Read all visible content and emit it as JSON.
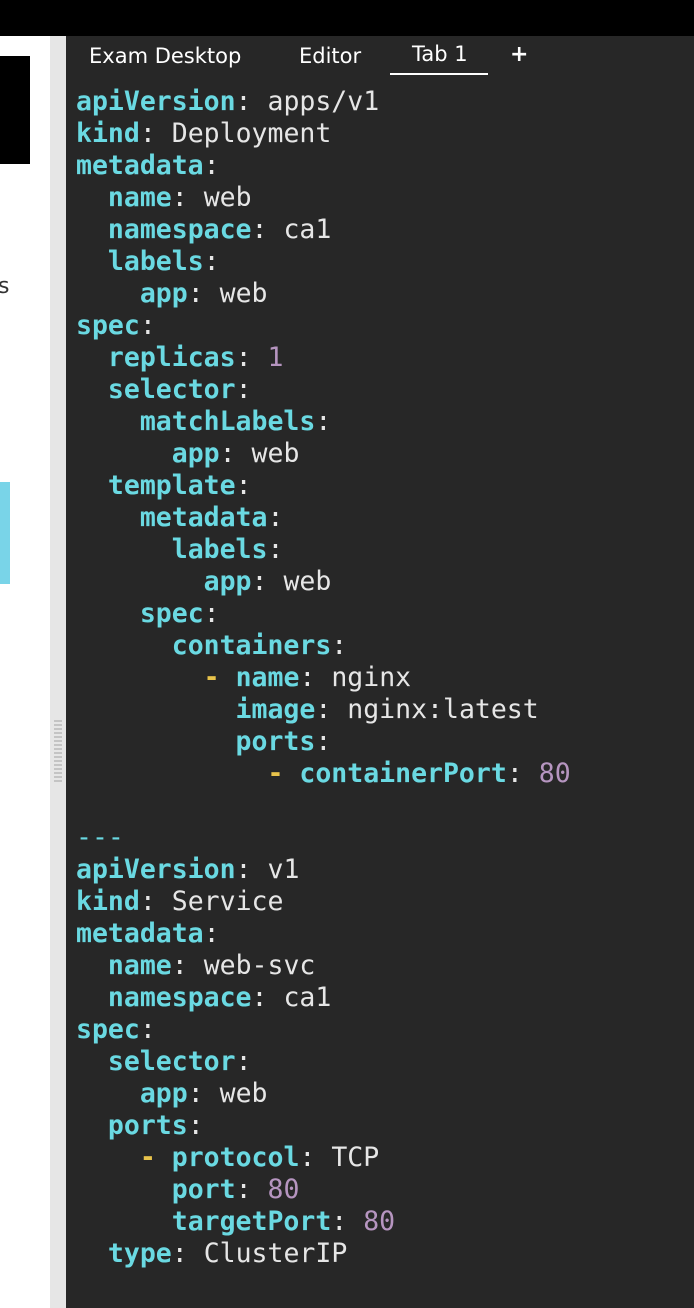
{
  "tabs": [
    {
      "label": "Exam Desktop",
      "active": false
    },
    {
      "label": "Editor",
      "active": false
    },
    {
      "label": "Tab 1",
      "active": true
    }
  ],
  "add_tab_label": "+",
  "left_panel": {
    "visible_text": "s"
  },
  "colors": {
    "editor_bg": "#272727",
    "key": "#6ad9e2",
    "number": "#b695c0",
    "dash": "#e8c34b",
    "text": "#e6e6e6",
    "left_accent": "#79d4e8"
  },
  "code": [
    {
      "indent": "",
      "key": "apiVersion",
      "value": "apps/v1",
      "type": "str"
    },
    {
      "indent": "",
      "key": "kind",
      "value": "Deployment",
      "type": "str"
    },
    {
      "indent": "",
      "key": "metadata"
    },
    {
      "indent": "  ",
      "key": "name",
      "value": "web",
      "type": "str"
    },
    {
      "indent": "  ",
      "key": "namespace",
      "value": "ca1",
      "type": "str"
    },
    {
      "indent": "  ",
      "key": "labels"
    },
    {
      "indent": "    ",
      "key": "app",
      "value": "web",
      "type": "str"
    },
    {
      "indent": "",
      "key": "spec"
    },
    {
      "indent": "  ",
      "key": "replicas",
      "value": "1",
      "type": "num"
    },
    {
      "indent": "  ",
      "key": "selector"
    },
    {
      "indent": "    ",
      "key": "matchLabels"
    },
    {
      "indent": "      ",
      "key": "app",
      "value": "web",
      "type": "str"
    },
    {
      "indent": "  ",
      "key": "template"
    },
    {
      "indent": "    ",
      "key": "metadata"
    },
    {
      "indent": "      ",
      "key": "labels"
    },
    {
      "indent": "        ",
      "key": "app",
      "value": "web",
      "type": "str"
    },
    {
      "indent": "    ",
      "key": "spec"
    },
    {
      "indent": "      ",
      "key": "containers"
    },
    {
      "indent": "        ",
      "dash": "-",
      "key": "name",
      "value": "nginx",
      "type": "str"
    },
    {
      "indent": "          ",
      "key": "image",
      "value": "nginx:latest",
      "type": "str"
    },
    {
      "indent": "          ",
      "key": "ports"
    },
    {
      "indent": "            ",
      "dash": "-",
      "key": "containerPort",
      "value": "80",
      "type": "num"
    },
    {
      "blank": true
    },
    {
      "separator": "---"
    },
    {
      "indent": "",
      "key": "apiVersion",
      "value": "v1",
      "type": "str"
    },
    {
      "indent": "",
      "key": "kind",
      "value": "Service",
      "type": "str"
    },
    {
      "indent": "",
      "key": "metadata"
    },
    {
      "indent": "  ",
      "key": "name",
      "value": "web-svc",
      "type": "str"
    },
    {
      "indent": "  ",
      "key": "namespace",
      "value": "ca1",
      "type": "str"
    },
    {
      "indent": "",
      "key": "spec"
    },
    {
      "indent": "  ",
      "key": "selector"
    },
    {
      "indent": "    ",
      "key": "app",
      "value": "web",
      "type": "str"
    },
    {
      "indent": "  ",
      "key": "ports"
    },
    {
      "indent": "    ",
      "dash": "-",
      "key": "protocol",
      "value": "TCP",
      "type": "str"
    },
    {
      "indent": "      ",
      "key": "port",
      "value": "80",
      "type": "num"
    },
    {
      "indent": "      ",
      "key": "targetPort",
      "value": "80",
      "type": "num"
    },
    {
      "indent": "  ",
      "key": "type",
      "value": "ClusterIP",
      "type": "str"
    }
  ]
}
